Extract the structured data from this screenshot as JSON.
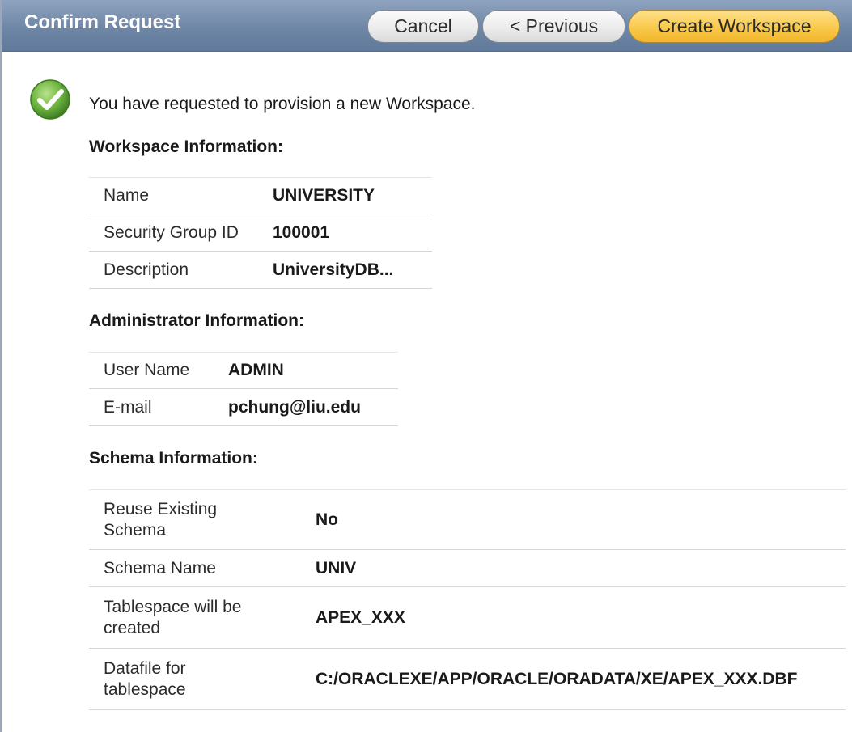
{
  "header": {
    "title": "Confirm Request",
    "buttons": {
      "cancel": "Cancel",
      "previous": "< Previous",
      "create": "Create Workspace"
    }
  },
  "intro": "You have requested to provision a new Workspace.",
  "workspace": {
    "title": "Workspace Information:",
    "rows": [
      {
        "label": "Name",
        "value": "UNIVERSITY"
      },
      {
        "label": "Security Group ID",
        "value": "100001"
      },
      {
        "label": "Description",
        "value": "UniversityDB..."
      }
    ]
  },
  "administrator": {
    "title": "Administrator Information:",
    "rows": [
      {
        "label": "User Name",
        "value": "ADMIN"
      },
      {
        "label": "E-mail",
        "value": "pchung@liu.edu"
      }
    ]
  },
  "schema": {
    "title": "Schema Information:",
    "rows": [
      {
        "label": "Reuse Existing Schema",
        "value": "No"
      },
      {
        "label": "Schema Name",
        "value": "UNIV"
      },
      {
        "label": "Tablespace will be created",
        "value": "APEX_XXX"
      },
      {
        "label": "Datafile for tablespace",
        "value": "C:/ORACLEXE/APP/ORACLE/ORADATA/XE/APEX_XXX.DBF"
      }
    ]
  },
  "icons": {
    "success": "check-icon"
  },
  "colors": {
    "header": "#6f87a6",
    "primary_button": "#f9c94b",
    "check": "#6cb33e"
  }
}
